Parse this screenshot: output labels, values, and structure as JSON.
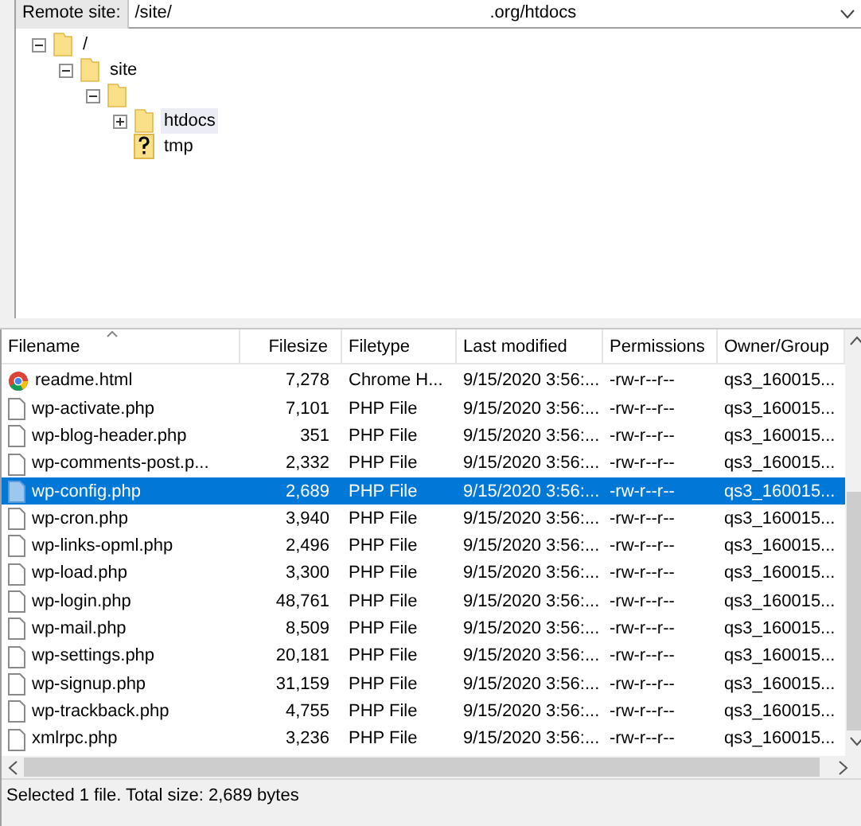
{
  "remote_site": {
    "label": "Remote site:",
    "path": "/site/",
    "path_end": ".org/htdocs"
  },
  "tree": [
    {
      "label": "/",
      "kind": "folder",
      "expanded": true,
      "selected": false,
      "children": [
        {
          "label": "site",
          "kind": "folder",
          "expanded": true,
          "selected": false,
          "children": [
            {
              "kind": "folder",
              "expanded": true,
              "children": [
                {
                  "label": "htdocs",
                  "kind": "folder",
                  "expanded": false,
                  "selected": true
                },
                {
                  "label": "tmp",
                  "kind": "unknown",
                  "selected": false
                }
              ]
            }
          ]
        }
      ]
    }
  ],
  "table": {
    "columns": [
      "Filename",
      "Filesize",
      "Filetype",
      "Last modified",
      "Permissions",
      "Owner/Group"
    ],
    "rows": [
      {
        "kind": "chrome",
        "selected": false,
        "cells": [
          "readme.html",
          "7,278",
          "Chrome H...",
          "9/15/2020 3:56:...",
          "-rw-r--r--",
          "qs3_160015..."
        ]
      },
      {
        "kind": "file",
        "selected": false,
        "cells": [
          "wp-activate.php",
          "7,101",
          "PHP File",
          "9/15/2020 3:56:...",
          "-rw-r--r--",
          "qs3_160015..."
        ]
      },
      {
        "kind": "file",
        "selected": false,
        "cells": [
          "wp-blog-header.php",
          "351",
          "PHP File",
          "9/15/2020 3:56:...",
          "-rw-r--r--",
          "qs3_160015..."
        ]
      },
      {
        "kind": "file",
        "selected": false,
        "cells": [
          "wp-comments-post.p...",
          "2,332",
          "PHP File",
          "9/15/2020 3:56:...",
          "-rw-r--r--",
          "qs3_160015..."
        ]
      },
      {
        "kind": "file",
        "selected": true,
        "cells": [
          "wp-config.php",
          "2,689",
          "PHP File",
          "9/15/2020 3:56:...",
          "-rw-r--r--",
          "qs3_160015..."
        ]
      },
      {
        "kind": "file",
        "selected": false,
        "cells": [
          "wp-cron.php",
          "3,940",
          "PHP File",
          "9/15/2020 3:56:...",
          "-rw-r--r--",
          "qs3_160015..."
        ]
      },
      {
        "kind": "file",
        "selected": false,
        "cells": [
          "wp-links-opml.php",
          "2,496",
          "PHP File",
          "9/15/2020 3:56:...",
          "-rw-r--r--",
          "qs3_160015..."
        ]
      },
      {
        "kind": "file",
        "selected": false,
        "cells": [
          "wp-load.php",
          "3,300",
          "PHP File",
          "9/15/2020 3:56:...",
          "-rw-r--r--",
          "qs3_160015..."
        ]
      },
      {
        "kind": "file",
        "selected": false,
        "cells": [
          "wp-login.php",
          "48,761",
          "PHP File",
          "9/15/2020 3:56:...",
          "-rw-r--r--",
          "qs3_160015..."
        ]
      },
      {
        "kind": "file",
        "selected": false,
        "cells": [
          "wp-mail.php",
          "8,509",
          "PHP File",
          "9/15/2020 3:56:...",
          "-rw-r--r--",
          "qs3_160015..."
        ]
      },
      {
        "kind": "file",
        "selected": false,
        "cells": [
          "wp-settings.php",
          "20,181",
          "PHP File",
          "9/15/2020 3:56:...",
          "-rw-r--r--",
          "qs3_160015..."
        ]
      },
      {
        "kind": "file",
        "selected": false,
        "cells": [
          "wp-signup.php",
          "31,159",
          "PHP File",
          "9/15/2020 3:56:...",
          "-rw-r--r--",
          "qs3_160015..."
        ]
      },
      {
        "kind": "file",
        "selected": false,
        "cells": [
          "wp-trackback.php",
          "4,755",
          "PHP File",
          "9/15/2020 3:56:...",
          "-rw-r--r--",
          "qs3_160015..."
        ]
      },
      {
        "kind": "file",
        "selected": false,
        "cells": [
          "xmlrpc.php",
          "3,236",
          "PHP File",
          "9/15/2020 3:56:...",
          "-rw-r--r--",
          "qs3_160015..."
        ]
      }
    ]
  },
  "status_bar": "Selected 1 file. Total size: 2,689 bytes"
}
